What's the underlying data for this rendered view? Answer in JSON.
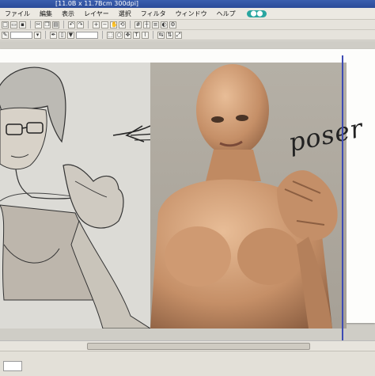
{
  "window": {
    "title": "[11.0B x 11.7Bcm 300dpi]"
  },
  "menu": {
    "items": [
      "ファイル",
      "編集",
      "表示",
      "レイヤー",
      "選択",
      "フィルタ",
      "ウィンドウ",
      "ヘルプ"
    ],
    "badge": "⬤⬤"
  },
  "canvas": {
    "annotation": "poser"
  },
  "status": {
    "zoom": ""
  },
  "colors": {
    "title_bar": "#2b4b99",
    "guide_line": "#3e4bb4",
    "badge": "#2aa6a0"
  }
}
